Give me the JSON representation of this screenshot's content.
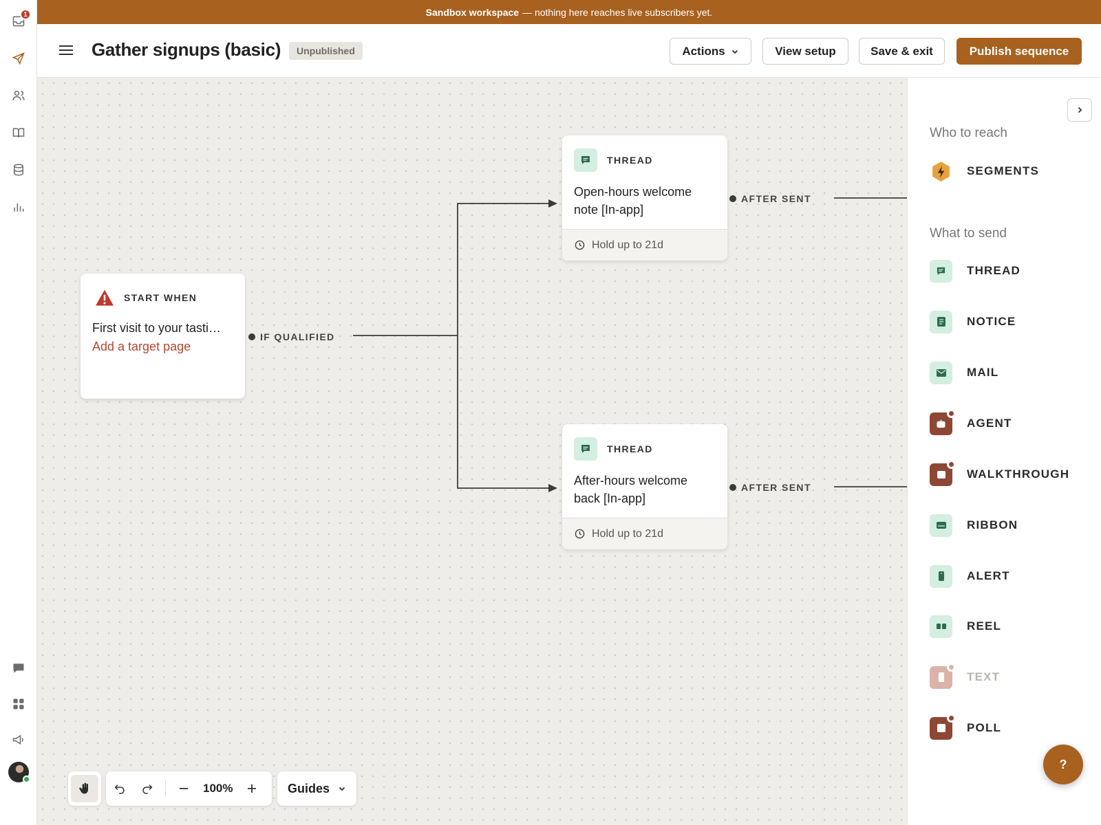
{
  "banner": {
    "bold": "Sandbox workspace",
    "rest": "— nothing here reaches live subscribers yet."
  },
  "rail": {
    "inbox_badge": "1",
    "icons": [
      "inbox-icon",
      "send-icon",
      "users-icon",
      "book-icon",
      "database-icon",
      "bar-chart-icon",
      "chat-icon",
      "apps-grid-icon",
      "megaphone-icon"
    ]
  },
  "header": {
    "title": "Gather signups (basic)",
    "status": "Unpublished",
    "actions_label": "Actions",
    "view_setup_label": "View setup",
    "save_exit_label": "Save & exit",
    "publish_label": "Publish sequence"
  },
  "canvas": {
    "start_node": {
      "type": "START WHEN",
      "title": "First visit to your tasti…",
      "link": "Add a target page"
    },
    "edge_if_qualified": "IF QUALIFIED",
    "nodes": [
      {
        "type": "THREAD",
        "title": "Open-hours welcome note [In-app]",
        "hold": "Hold up to 21d",
        "edge": "AFTER SENT"
      },
      {
        "type": "THREAD",
        "title": "After-hours welcome back [In-app]",
        "hold": "Hold up to 21d",
        "edge": "AFTER SENT"
      }
    ],
    "zoom": "100%",
    "guides_label": "Guides"
  },
  "panel": {
    "who_title": "Who to reach",
    "who_items": [
      {
        "label": "SEGMENTS",
        "icon": "segments-bolt-icon"
      }
    ],
    "what_title": "What to send",
    "what_items": [
      {
        "label": "THREAD",
        "icon": "thread-icon",
        "style": "green"
      },
      {
        "label": "NOTICE",
        "icon": "notice-icon",
        "style": "green"
      },
      {
        "label": "MAIL",
        "icon": "mail-icon",
        "style": "green"
      },
      {
        "label": "AGENT",
        "icon": "agent-icon",
        "style": "brown"
      },
      {
        "label": "WALKTHROUGH",
        "icon": "walkthrough-icon",
        "style": "brown"
      },
      {
        "label": "RIBBON",
        "icon": "ribbon-icon",
        "style": "green"
      },
      {
        "label": "ALERT",
        "icon": "alert-icon",
        "style": "green"
      },
      {
        "label": "REEL",
        "icon": "reel-icon",
        "style": "green"
      },
      {
        "label": "TEXT",
        "icon": "text-icon",
        "style": "faded"
      },
      {
        "label": "POLL",
        "icon": "poll-icon",
        "style": "brown"
      }
    ]
  },
  "help_label": "?",
  "colors": {
    "accent": "#a8611f",
    "danger": "#c0392b",
    "thread_bg": "#d4eee0",
    "brown_item": "#8e4734"
  }
}
